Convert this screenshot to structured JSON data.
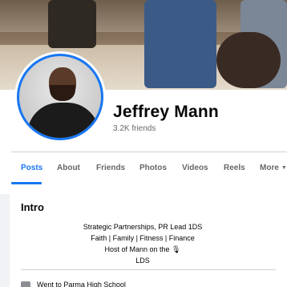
{
  "profile": {
    "name": "Jeffrey Mann",
    "friends_count": "3.2K friends"
  },
  "tabs": [
    {
      "label": "Posts",
      "active": true
    },
    {
      "label": "About",
      "active": false
    },
    {
      "label": "Friends",
      "active": false
    },
    {
      "label": "Photos",
      "active": false
    },
    {
      "label": "Videos",
      "active": false
    },
    {
      "label": "Reels",
      "active": false
    },
    {
      "label": "More",
      "active": false
    }
  ],
  "intro": {
    "title": "Intro",
    "bio_lines": [
      "Strategic Partnerships, PR Lead 1DS",
      "Faith | Family | Fitness | Finance",
      "Host of Mann on the 🎙",
      "LDS"
    ],
    "education": "Went to Parma High School"
  },
  "colors": {
    "accent": "#1877f2",
    "page_bg": "#f0f2f5",
    "card_bg": "#ffffff",
    "secondary_text": "#65676b"
  },
  "icons": {
    "more_caret": "caret-down-icon",
    "education": "school-icon"
  }
}
